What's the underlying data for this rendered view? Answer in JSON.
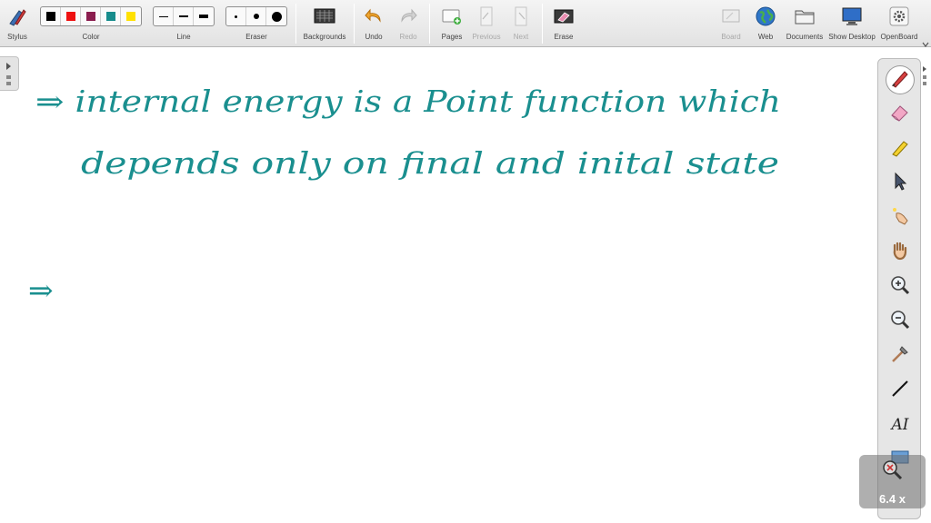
{
  "toolbar": {
    "stylus": "Stylus",
    "color": "Color",
    "line": "Line",
    "eraser": "Eraser",
    "backgrounds": "Backgrounds",
    "undo": "Undo",
    "redo": "Redo",
    "pages": "Pages",
    "previous": "Previous",
    "next": "Next",
    "erase": "Erase",
    "board": "Board",
    "web": "Web",
    "documents": "Documents",
    "show_desktop": "Show Desktop",
    "openboard": "OpenBoard"
  },
  "palette": {
    "colors": [
      "#000000",
      "#ee1111",
      "#8a1d4e",
      "#178c8c",
      "#ffe100"
    ],
    "ink": "#1a8f8f"
  },
  "board": {
    "line1": "⇒ internal energy is a Point function which",
    "line2": "depends only on final and inital state",
    "line3": "⇒"
  },
  "dock": {
    "tools": [
      "pen-icon",
      "eraser-icon",
      "highlighter-icon",
      "pointer-icon",
      "laser-icon",
      "hand-icon",
      "zoom-in-icon",
      "zoom-out-icon",
      "capture-icon",
      "line-icon",
      "text-icon",
      "screen-capture-icon"
    ],
    "text_tool_label": "AI"
  },
  "zoom": {
    "label": "6.4 x"
  }
}
